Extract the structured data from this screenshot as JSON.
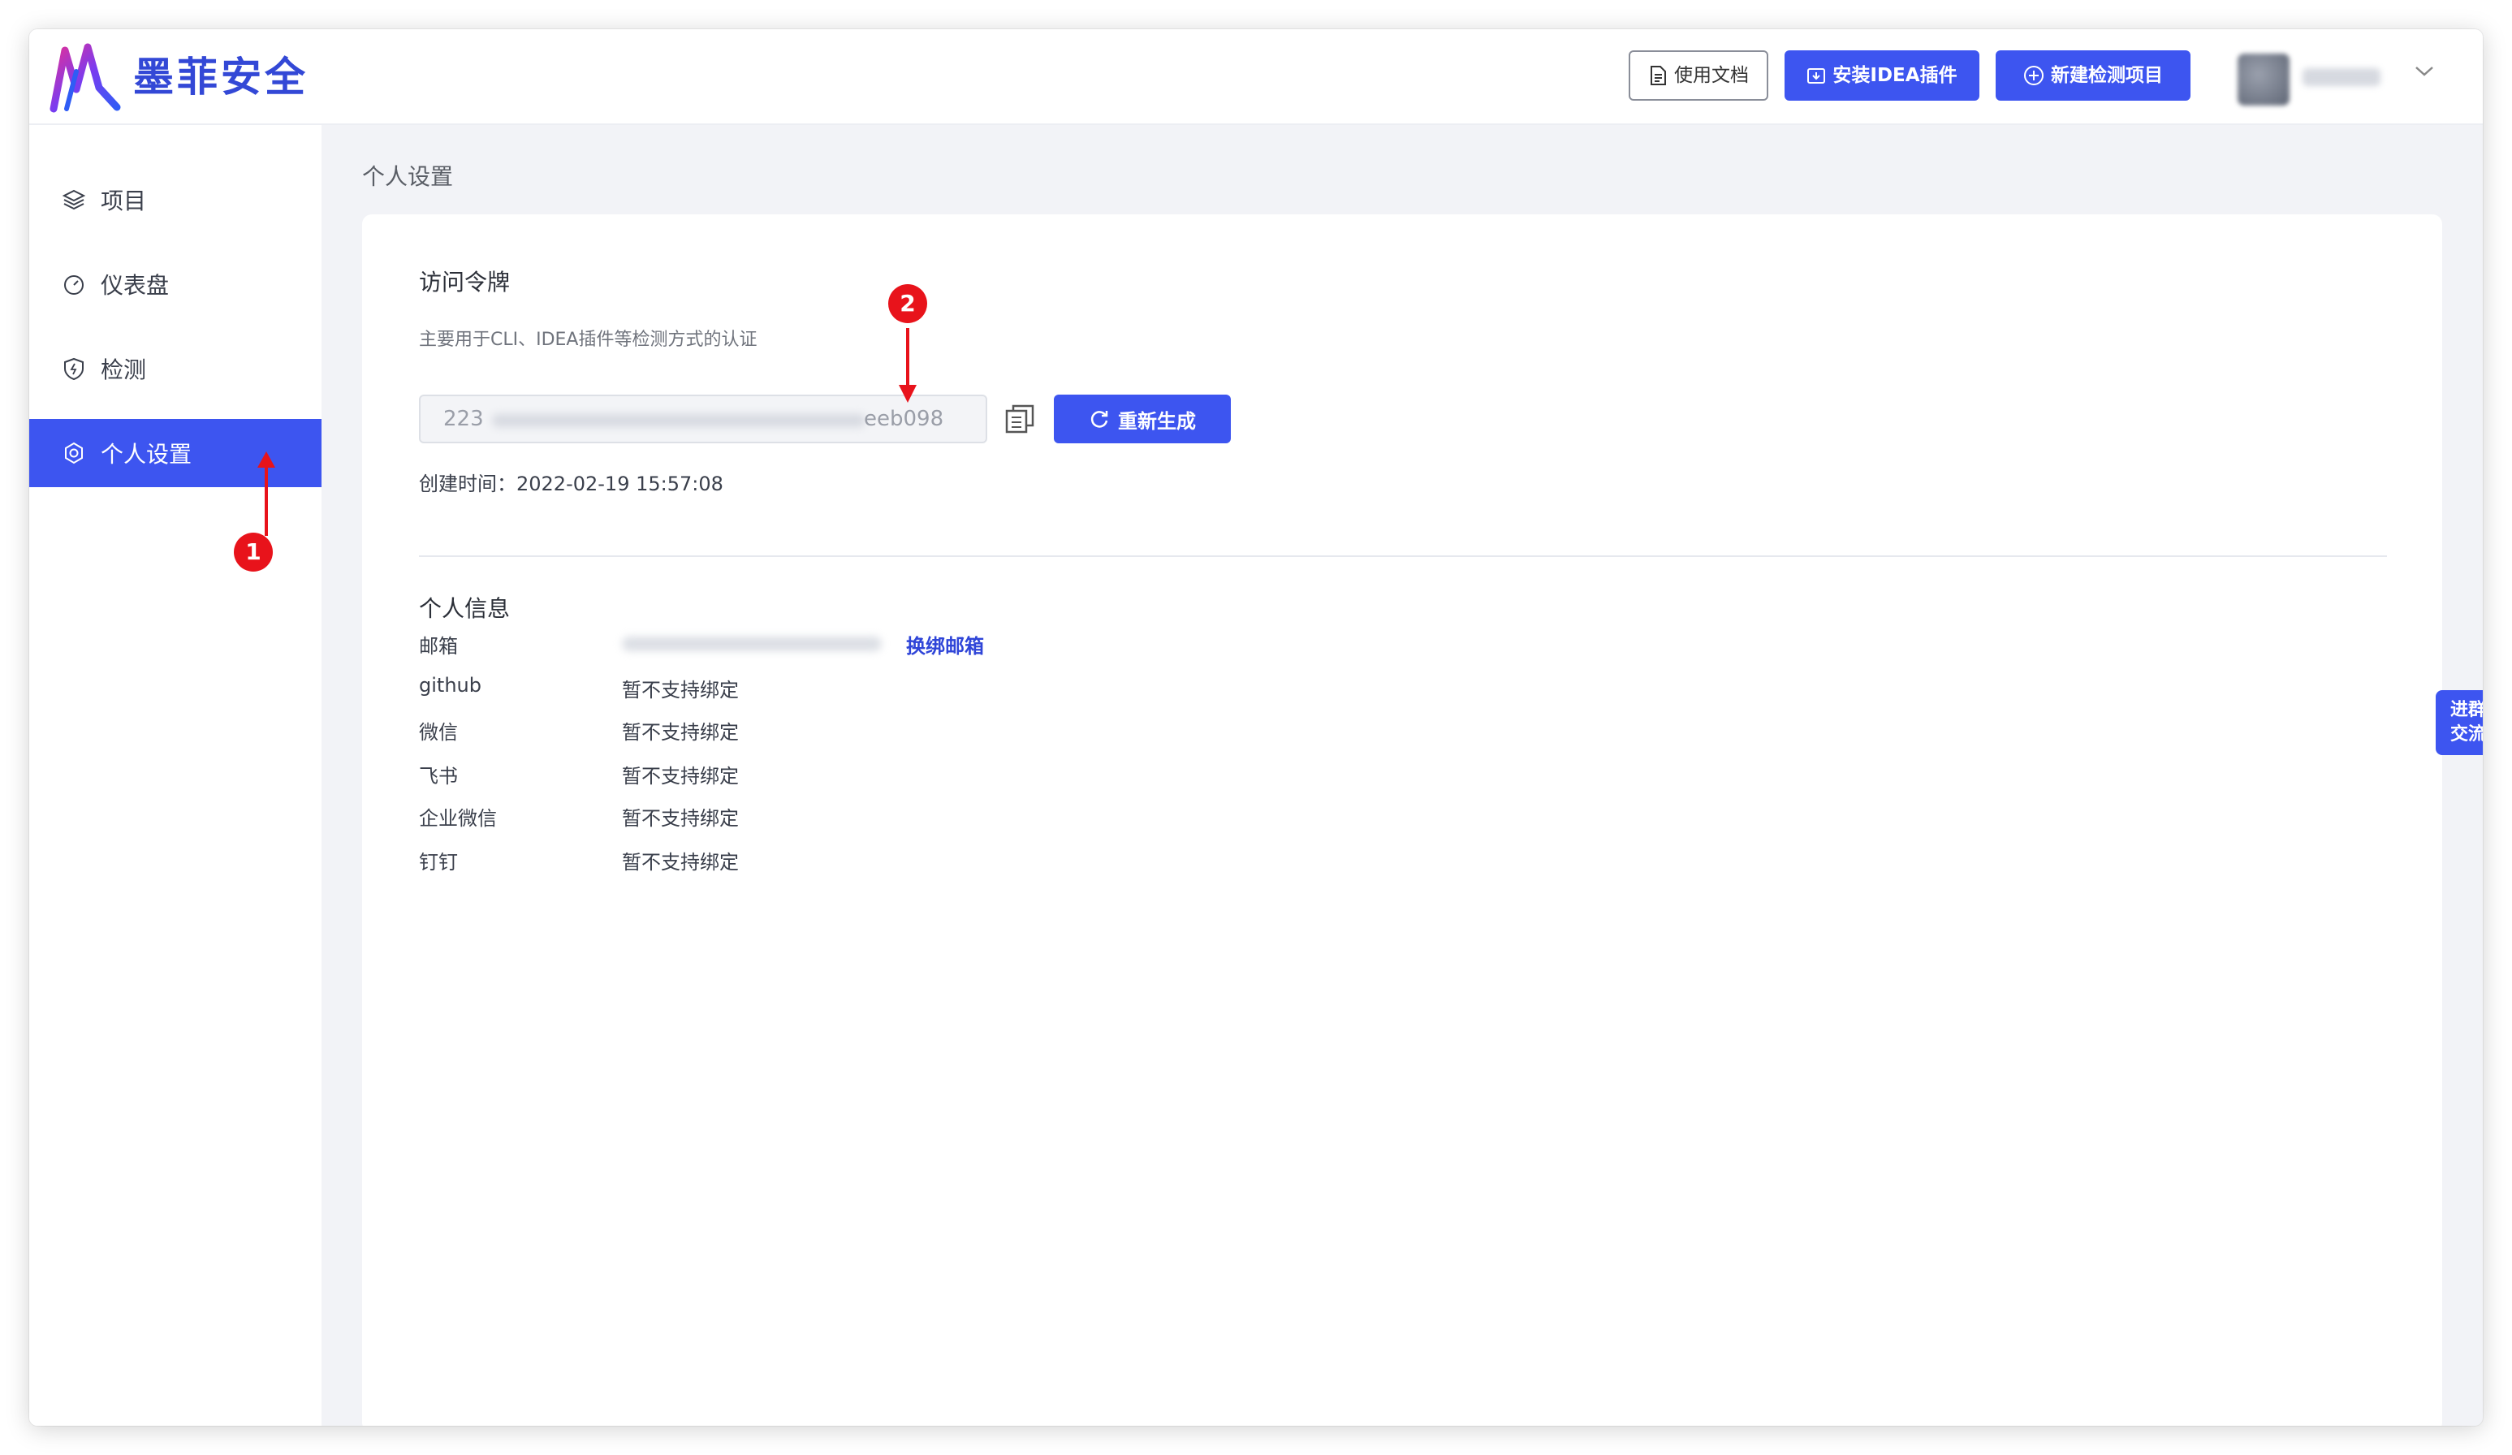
{
  "app": {
    "brand": "墨菲安全"
  },
  "header": {
    "docs_label": "使用文档",
    "install_label": "安装IDEA插件",
    "new_project_label": "新建检测项目"
  },
  "sidebar": {
    "items": [
      {
        "label": "项目",
        "icon": "layers-icon"
      },
      {
        "label": "仪表盘",
        "icon": "gauge-icon"
      },
      {
        "label": "检测",
        "icon": "shield-icon"
      },
      {
        "label": "个人设置",
        "icon": "gear-icon",
        "active": true
      }
    ]
  },
  "page": {
    "breadcrumb": "个人设置"
  },
  "token": {
    "title": "访问令牌",
    "description": "主要用于CLI、IDEA插件等检测方式的认证",
    "prefix": "223",
    "suffix": "eeb098",
    "regenerate_label": "重新生成",
    "created_label": "创建时间：2022-02-19 15:57:08"
  },
  "profile": {
    "title": "个人信息",
    "email": {
      "label": "邮箱",
      "action": "换绑邮箱"
    },
    "bindings": [
      {
        "label": "github",
        "value": "暂不支持绑定"
      },
      {
        "label": "微信",
        "value": "暂不支持绑定"
      },
      {
        "label": "飞书",
        "value": "暂不支持绑定"
      },
      {
        "label": "企业微信",
        "value": "暂不支持绑定"
      },
      {
        "label": "钉钉",
        "value": "暂不支持绑定"
      }
    ]
  },
  "floating": {
    "line1": "进群",
    "line2": "交流"
  },
  "annotations": {
    "marker1": "1",
    "marker2": "2"
  },
  "colors": {
    "accent": "#3d55f0",
    "marker": "#e8131b"
  }
}
